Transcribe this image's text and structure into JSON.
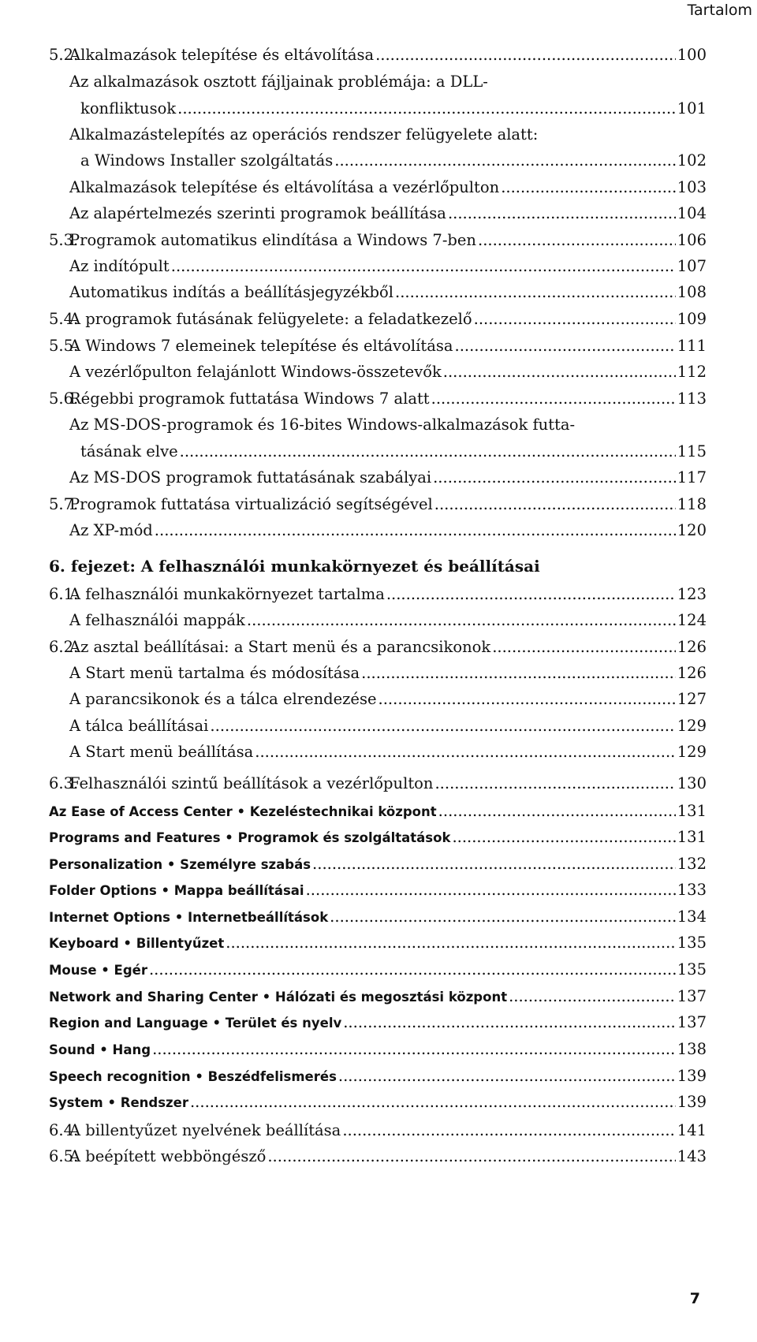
{
  "header": {
    "title": "Tartalom"
  },
  "footer": {
    "page_number": "7"
  },
  "entries": [
    {
      "num": "5.2.",
      "title": [
        "Alkalmazások telepítése és eltávolítása"
      ],
      "page": "100"
    },
    {
      "num": "",
      "title": [
        "Az alkalmazások osztott fájljainak problémája: a DLL-",
        "konfliktusok"
      ],
      "page": "101"
    },
    {
      "num": "",
      "title": [
        "Alkalmazástelepítés az operációs rendszer felügyelete alatt:",
        "a Windows Installer szolgáltatás"
      ],
      "page": "102"
    },
    {
      "num": "",
      "title": [
        "Alkalmazások telepítése és eltávolítása a vezérlőpulton"
      ],
      "page": "103"
    },
    {
      "num": "",
      "title": [
        "Az alapértelmezés szerinti programok beállítása"
      ],
      "page": "104"
    },
    {
      "num": "5.3.",
      "title": [
        "Programok automatikus elindítása a Windows 7-ben"
      ],
      "page": "106"
    },
    {
      "num": "",
      "title": [
        "Az indítópult"
      ],
      "page": "107"
    },
    {
      "num": "",
      "title": [
        "Automatikus indítás a beállításjegyzékből"
      ],
      "page": "108"
    },
    {
      "num": "5.4.",
      "title": [
        "A programok futásának felügyelete: a feladatkezelő"
      ],
      "page": "109"
    },
    {
      "num": "5.5.",
      "title": [
        "A Windows 7 elemeinek telepítése és eltávolítása"
      ],
      "page": "111"
    },
    {
      "num": "",
      "title": [
        "A vezérlőpulton felajánlott Windows-összetevők"
      ],
      "page": "112"
    },
    {
      "num": "5.6.",
      "title": [
        "Régebbi programok futtatása Windows 7 alatt"
      ],
      "page": "113"
    },
    {
      "num": "",
      "title": [
        "Az MS-DOS-programok és 16-bites Windows-alkalmazások futta-",
        "tásának elve"
      ],
      "page": "115"
    },
    {
      "num": "",
      "title": [
        "Az MS-DOS programok futtatásának szabályai"
      ],
      "page": "117"
    },
    {
      "num": "5.7.",
      "title": [
        "Programok futtatása virtualizáció segítségével"
      ],
      "page": "118"
    },
    {
      "num": "",
      "title": [
        "Az XP-mód"
      ],
      "page": "120"
    },
    {
      "num": "",
      "title": [
        "6. fejezet: A felhasználói munkakörnyezet és beállításai"
      ],
      "page": "",
      "style": "chapter"
    },
    {
      "num": "6.1.",
      "title": [
        "A felhasználói munkakörnyezet tartalma"
      ],
      "page": "123"
    },
    {
      "num": "",
      "title": [
        "A felhasználói mappák"
      ],
      "page": "124"
    },
    {
      "num": "6.2.",
      "title": [
        "Az asztal beállításai: a Start menü és a parancsikonok"
      ],
      "page": "126"
    },
    {
      "num": "",
      "title": [
        "A Start menü tartalma és módosítása"
      ],
      "page": "126"
    },
    {
      "num": "",
      "title": [
        "A parancsikonok és a tálca elrendezése"
      ],
      "page": "127"
    },
    {
      "num": "",
      "title": [
        "A tálca beállításai"
      ],
      "page": "129"
    },
    {
      "num": "",
      "title": [
        "A Start menü beállítása"
      ],
      "page": "129"
    },
    {
      "num": "6.3.",
      "title": [
        "Felhasználói szintű beállítások a vezérlőpulton"
      ],
      "page": "130"
    },
    {
      "num": "",
      "title": [
        "Az Ease of Access Center • Kezeléstechnikai központ"
      ],
      "page": "131",
      "style": "sans"
    },
    {
      "num": "",
      "title": [
        "Programs and Features • Programok és szolgáltatások"
      ],
      "page": "131",
      "style": "sans"
    },
    {
      "num": "",
      "title": [
        "Personalization • Személyre szabás"
      ],
      "page": "132",
      "style": "sans"
    },
    {
      "num": "",
      "title": [
        "Folder Options • Mappa beállításai"
      ],
      "page": "133",
      "style": "sans"
    },
    {
      "num": "",
      "title": [
        "Internet Options • Internetbeállítások"
      ],
      "page": "134",
      "style": "sans"
    },
    {
      "num": "",
      "title": [
        "Keyboard • Billentyűzet"
      ],
      "page": "135",
      "style": "sans"
    },
    {
      "num": "",
      "title": [
        "Mouse • Egér"
      ],
      "page": "135",
      "style": "sans"
    },
    {
      "num": "",
      "title": [
        "Network and Sharing Center • Hálózati és megosztási központ"
      ],
      "page": "137",
      "style": "sans"
    },
    {
      "num": "",
      "title": [
        "Region and Language • Terület és nyelv"
      ],
      "page": "137",
      "style": "sans"
    },
    {
      "num": "",
      "title": [
        "Sound • Hang"
      ],
      "page": "138",
      "style": "sans"
    },
    {
      "num": "",
      "title": [
        "Speech recognition • Beszédfelismerés"
      ],
      "page": "139",
      "style": "sans"
    },
    {
      "num": "",
      "title": [
        "System • Rendszer"
      ],
      "page": "139",
      "style": "sans"
    },
    {
      "num": "6.4.",
      "title": [
        "A billentyűzet nyelvének beállítása"
      ],
      "page": "141"
    },
    {
      "num": "6.5.",
      "title": [
        "A beépített webböngésző"
      ],
      "page": "143"
    }
  ]
}
